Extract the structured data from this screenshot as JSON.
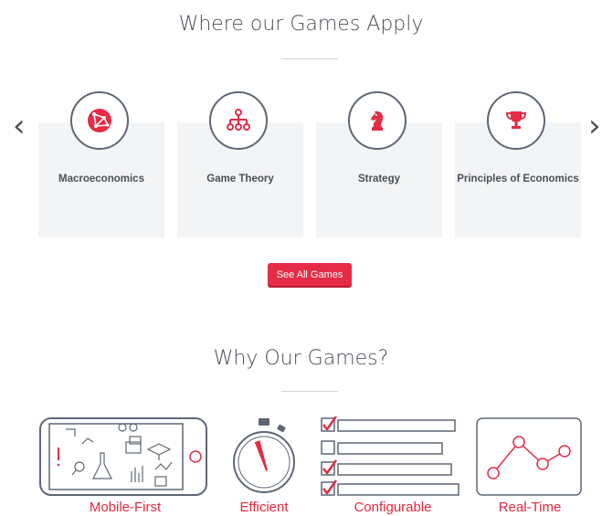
{
  "section1": {
    "title": "Where our Games Apply",
    "cards": [
      {
        "label": "Macroeconomics",
        "icon": "globe-network-icon"
      },
      {
        "label": "Game Theory",
        "icon": "hierarchy-icon"
      },
      {
        "label": "Strategy",
        "icon": "chess-knight-icon"
      },
      {
        "label": "Principles of Economics",
        "icon": "trophy-icon"
      }
    ],
    "cta_label": "See All Games"
  },
  "section2": {
    "title": "Why Our Games?",
    "features": [
      {
        "label": "Mobile-First",
        "icon": "phone-illustration-icon"
      },
      {
        "label": "Efficient",
        "icon": "stopwatch-icon"
      },
      {
        "label": "Configurable",
        "icon": "checklist-icon"
      },
      {
        "label": "Real-Time",
        "icon": "line-graph-icon"
      }
    ]
  },
  "colors": {
    "accent": "#e52b45",
    "text": "#4a4f59",
    "card_bg": "#f3f4f5",
    "outline": "#5e6775"
  }
}
